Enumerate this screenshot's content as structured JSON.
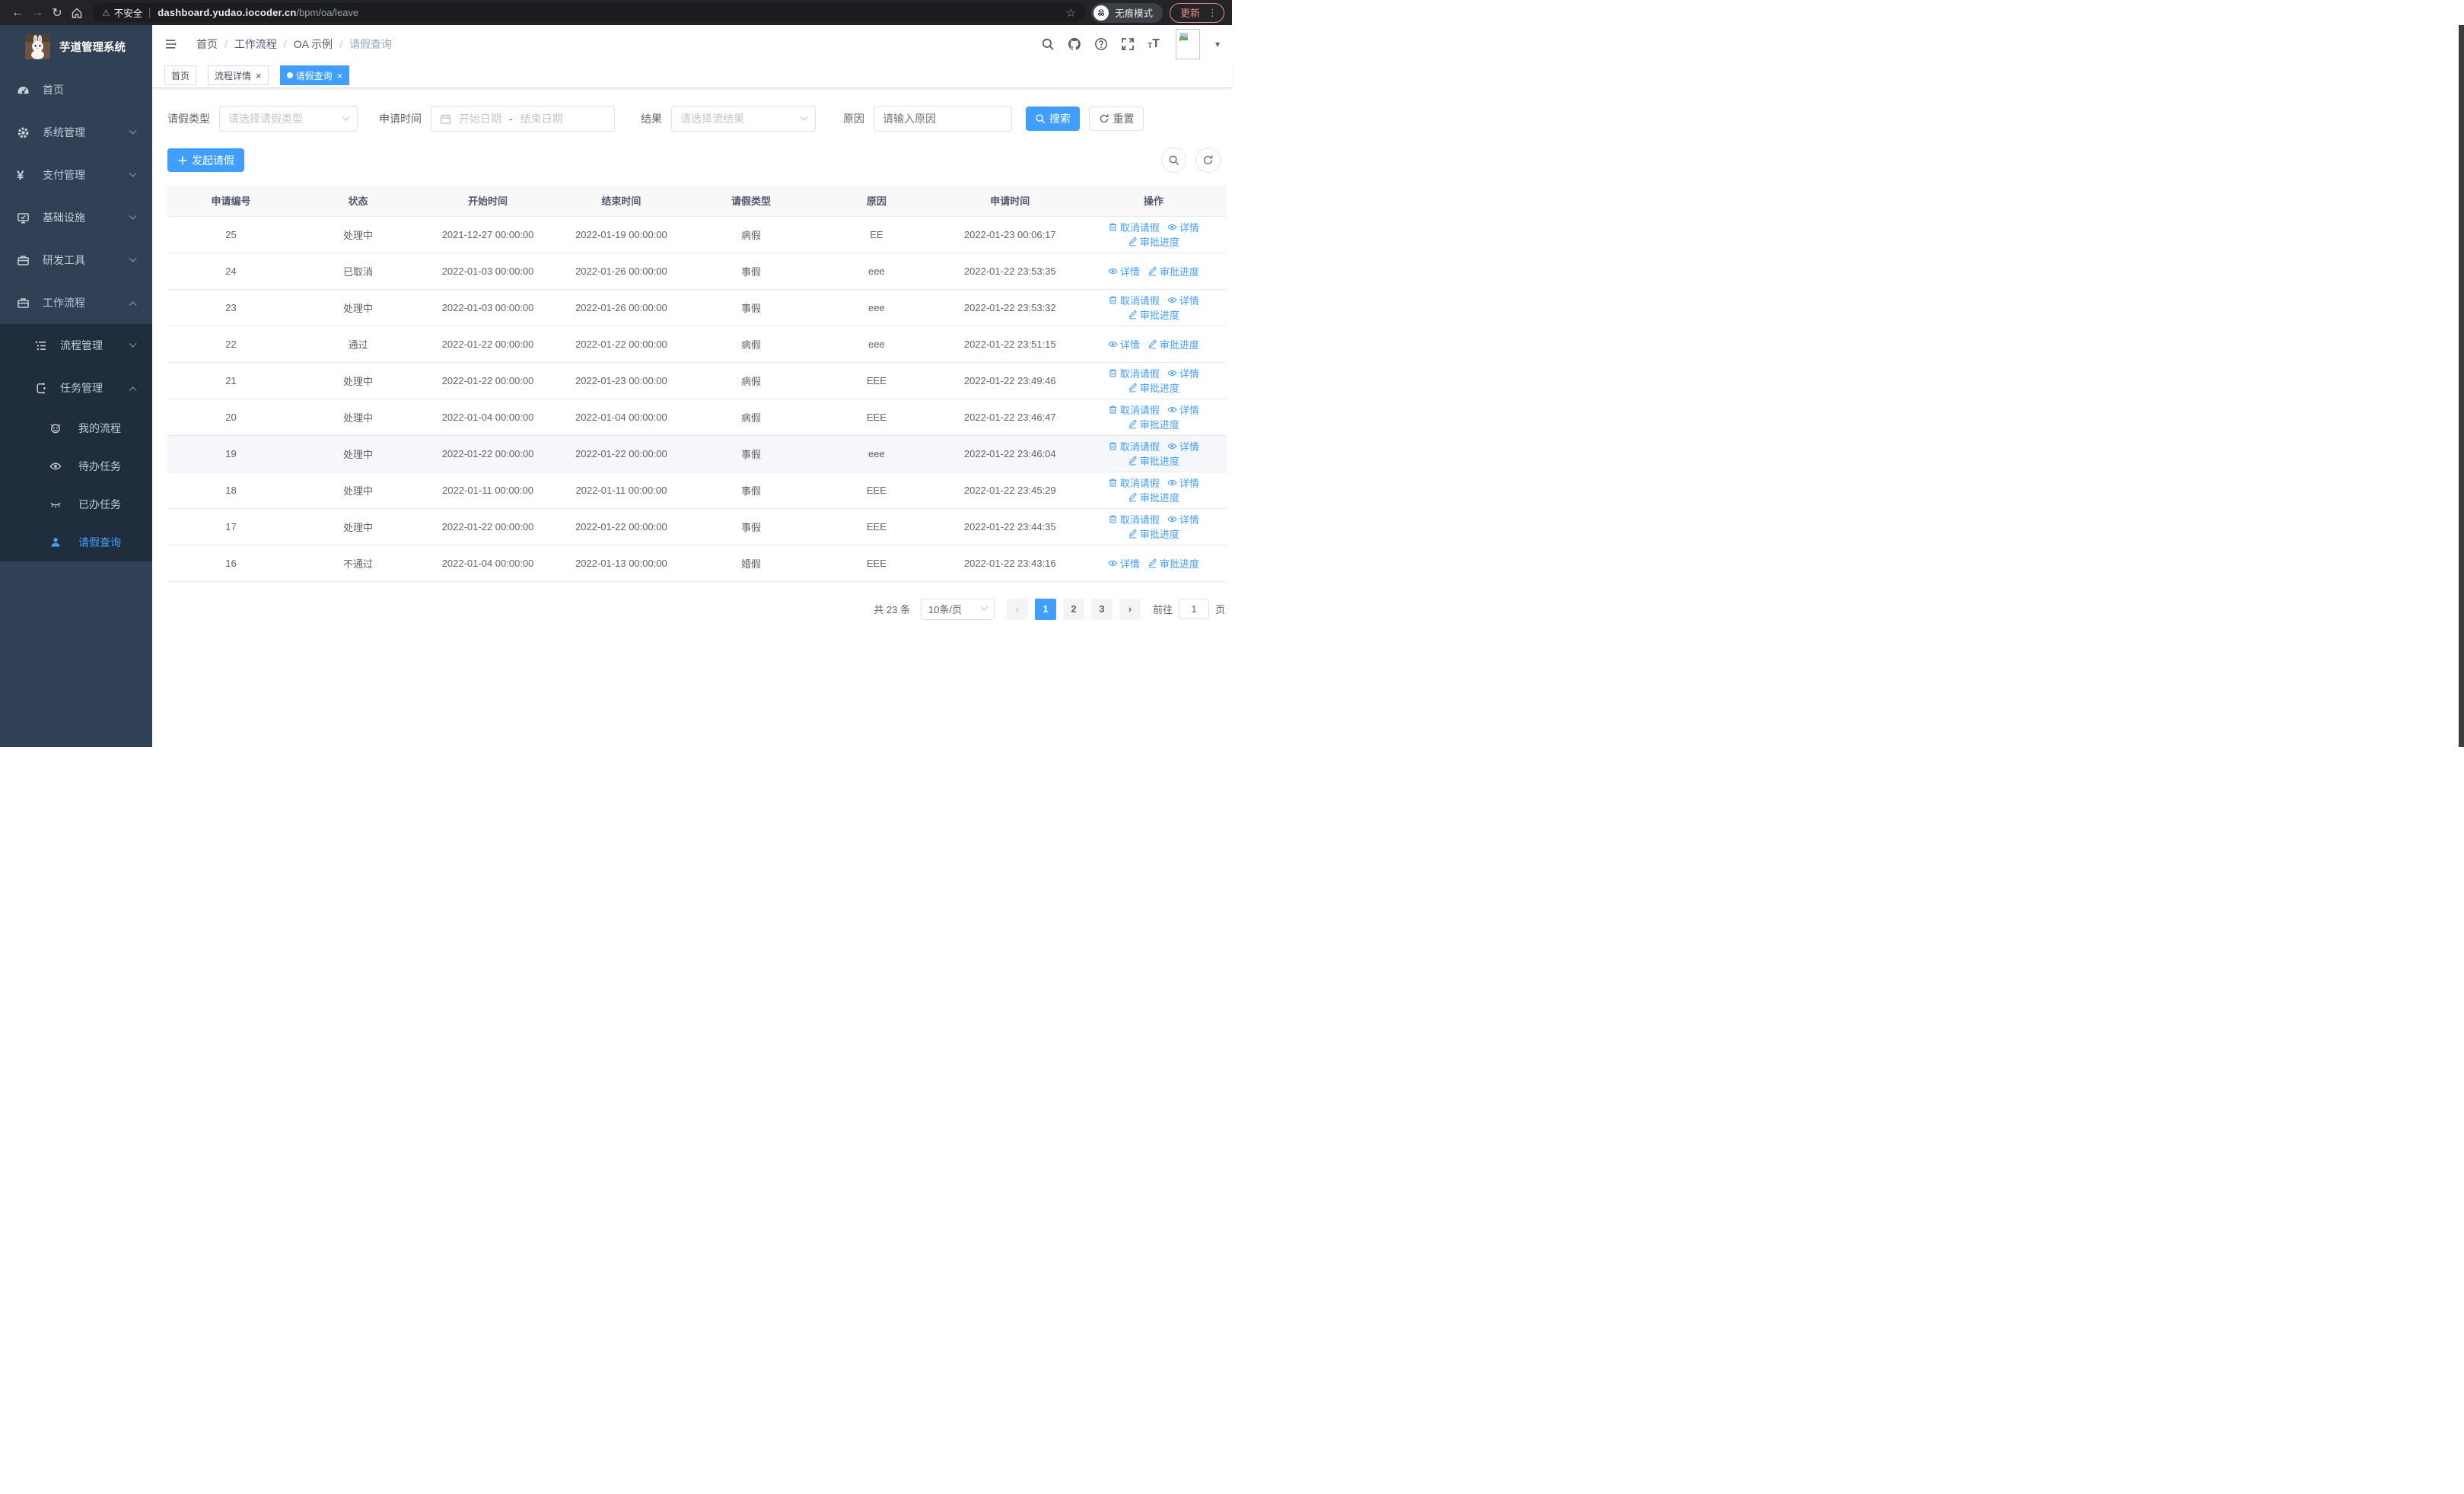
{
  "browser": {
    "security_label": "不安全",
    "url_domain": "dashboard.yudao.iocoder.cn",
    "url_path": "/bpm/oa/leave",
    "incognito_label": "无痕模式",
    "update_label": "更新",
    "glyphs": {
      "back": "←",
      "forward": "→",
      "reload": "↻",
      "warning": "⚠",
      "star": "☆",
      "menu_dots": "⋮"
    }
  },
  "sidebar": {
    "title": "芋道管理系统",
    "items": [
      {
        "label": "首页"
      },
      {
        "label": "系统管理"
      },
      {
        "label": "支付管理"
      },
      {
        "label": "基础设施"
      },
      {
        "label": "研发工具"
      },
      {
        "label": "工作流程"
      }
    ],
    "submenu": [
      {
        "label": "流程管理"
      },
      {
        "label": "任务管理"
      }
    ],
    "task_items": [
      {
        "label": "我的流程"
      },
      {
        "label": "待办任务"
      },
      {
        "label": "已办任务"
      },
      {
        "label": "请假查询"
      }
    ],
    "colors": {
      "bg": "#304156",
      "submenu_bg": "#1f2d3d",
      "text": "#bfcbd9",
      "active": "#409eff"
    }
  },
  "header": {
    "breadcrumb": [
      {
        "label": "首页"
      },
      {
        "label": "工作流程"
      },
      {
        "label": "OA 示例"
      },
      {
        "label": "请假查询"
      }
    ],
    "separator": "/",
    "font_small": "T",
    "font_big": "T",
    "caret": "▾"
  },
  "tabs": [
    {
      "label": "首页"
    },
    {
      "label": "流程详情"
    },
    {
      "label": "请假查询"
    }
  ],
  "tab_close_glyph": "×",
  "filters": {
    "leave_type": {
      "label": "请假类型",
      "placeholder": "请选择请假类型"
    },
    "apply_time": {
      "label": "申请时间",
      "start_placeholder": "开始日期",
      "separator": "-",
      "end_placeholder": "结束日期"
    },
    "result": {
      "label": "结果",
      "placeholder": "请选择流结果"
    },
    "reason": {
      "label": "原因",
      "placeholder": "请输入原因"
    },
    "search_label": "搜索",
    "reset_label": "重置"
  },
  "toolbar": {
    "create_label": "发起请假",
    "plus_glyph": "＋"
  },
  "table": {
    "columns": [
      "申请编号",
      "状态",
      "开始时间",
      "结束时间",
      "请假类型",
      "原因",
      "申请时间",
      "操作"
    ],
    "action_labels": {
      "cancel": "取消请假",
      "detail": "详情",
      "progress": "审批进度"
    },
    "rows": [
      {
        "id": "25",
        "status": "处理中",
        "start": "2021-12-27 00:00:00",
        "end": "2022-01-19 00:00:00",
        "type": "病假",
        "reason": "EE",
        "applied": "2022-01-23 00:06:17",
        "has_cancel": true
      },
      {
        "id": "24",
        "status": "已取消",
        "start": "2022-01-03 00:00:00",
        "end": "2022-01-26 00:00:00",
        "type": "事假",
        "reason": "eee",
        "applied": "2022-01-22 23:53:35",
        "has_cancel": false
      },
      {
        "id": "23",
        "status": "处理中",
        "start": "2022-01-03 00:00:00",
        "end": "2022-01-26 00:00:00",
        "type": "事假",
        "reason": "eee",
        "applied": "2022-01-22 23:53:32",
        "has_cancel": true
      },
      {
        "id": "22",
        "status": "通过",
        "start": "2022-01-22 00:00:00",
        "end": "2022-01-22 00:00:00",
        "type": "病假",
        "reason": "eee",
        "applied": "2022-01-22 23:51:15",
        "has_cancel": false
      },
      {
        "id": "21",
        "status": "处理中",
        "start": "2022-01-22 00:00:00",
        "end": "2022-01-23 00:00:00",
        "type": "病假",
        "reason": "EEE",
        "applied": "2022-01-22 23:49:46",
        "has_cancel": true
      },
      {
        "id": "20",
        "status": "处理中",
        "start": "2022-01-04 00:00:00",
        "end": "2022-01-04 00:00:00",
        "type": "病假",
        "reason": "EEE",
        "applied": "2022-01-22 23:46:47",
        "has_cancel": true
      },
      {
        "id": "19",
        "status": "处理中",
        "start": "2022-01-22 00:00:00",
        "end": "2022-01-22 00:00:00",
        "type": "事假",
        "reason": "eee",
        "applied": "2022-01-22 23:46:04",
        "has_cancel": true
      },
      {
        "id": "18",
        "status": "处理中",
        "start": "2022-01-11 00:00:00",
        "end": "2022-01-11 00:00:00",
        "type": "事假",
        "reason": "EEE",
        "applied": "2022-01-22 23:45:29",
        "has_cancel": true
      },
      {
        "id": "17",
        "status": "处理中",
        "start": "2022-01-22 00:00:00",
        "end": "2022-01-22 00:00:00",
        "type": "事假",
        "reason": "EEE",
        "applied": "2022-01-22 23:44:35",
        "has_cancel": true
      },
      {
        "id": "16",
        "status": "不通过",
        "start": "2022-01-04 00:00:00",
        "end": "2022-01-13 00:00:00",
        "type": "婚假",
        "reason": "EEE",
        "applied": "2022-01-22 23:43:16",
        "has_cancel": false
      }
    ]
  },
  "pagination": {
    "total": "共 23 条",
    "page_size": "10条/页",
    "prev": "‹",
    "next": "›",
    "pages": [
      "1",
      "2",
      "3"
    ],
    "active_page": "1",
    "goto_label": "前往",
    "goto_value": "1",
    "page_suffix": "页"
  },
  "colors": {
    "primary": "#409eff",
    "update_accent": "#ef8b81"
  }
}
